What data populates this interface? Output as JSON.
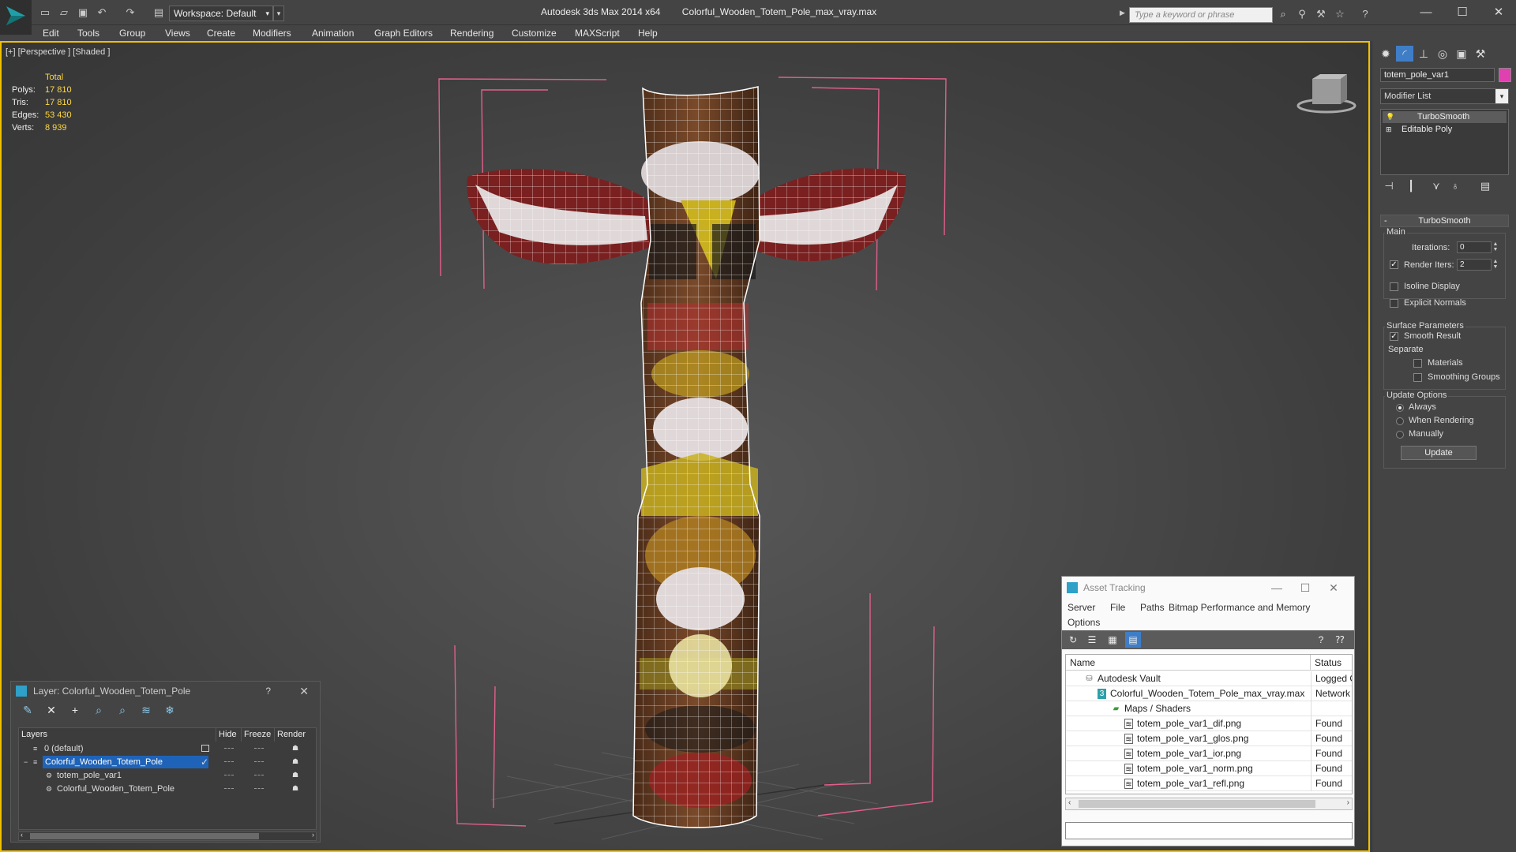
{
  "titlebar": {
    "workspace": "Workspace: Default",
    "app_name": "Autodesk 3ds Max  2014 x64",
    "file_name": "Colorful_Wooden_Totem_Pole_max_vray.max",
    "search_placeholder": "Type a keyword or phrase"
  },
  "menu": [
    "Edit",
    "Tools",
    "Group",
    "Views",
    "Create",
    "Modifiers",
    "Animation",
    "Graph Editors",
    "Rendering",
    "Customize",
    "MAXScript",
    "Help"
  ],
  "viewport": {
    "label": "[+] [Perspective ] [Shaded ]",
    "stats_header": "Total",
    "stats": [
      {
        "k": "Polys:",
        "v": "17 810"
      },
      {
        "k": "Tris:",
        "v": "17 810"
      },
      {
        "k": "Edges:",
        "v": "53 430"
      },
      {
        "k": "Verts:",
        "v": "8 939"
      }
    ]
  },
  "command_panel": {
    "object_name": "totem_pole_var1",
    "object_color": "#e040b0",
    "modifier_list": "Modifier List",
    "stack": [
      "TurboSmooth",
      "Editable Poly"
    ],
    "rollout_title": "TurboSmooth",
    "main_label": "Main",
    "iterations_label": "Iterations:",
    "iterations_value": "0",
    "render_iters_label": "Render Iters:",
    "render_iters_value": "2",
    "isoline_label": "Isoline Display",
    "explicit_normals_label": "Explicit Normals",
    "surface_params_label": "Surface Parameters",
    "smooth_result_label": "Smooth Result",
    "separate_label": "Separate",
    "materials_label": "Materials",
    "smoothing_groups_label": "Smoothing Groups",
    "update_options_label": "Update Options",
    "always_label": "Always",
    "when_rendering_label": "When Rendering",
    "manually_label": "Manually",
    "update_button": "Update"
  },
  "layer_panel": {
    "title": "Layer: Colorful_Wooden_Totem_Pole",
    "help": "?",
    "columns": [
      "Layers",
      "Hide",
      "Freeze",
      "Render"
    ],
    "rows": [
      {
        "name": "0 (default)"
      },
      {
        "name": "Colorful_Wooden_Totem_Pole"
      },
      {
        "name": "totem_pole_var1"
      },
      {
        "name": "Colorful_Wooden_Totem_Pole"
      }
    ]
  },
  "asset_tracking": {
    "title": "Asset Tracking",
    "menu": [
      "Server",
      "File",
      "Paths",
      "Bitmap Performance and Memory",
      "Options"
    ],
    "columns": [
      "Name",
      "Status"
    ],
    "rows": [
      {
        "name": "Autodesk Vault",
        "status": "Logged Out"
      },
      {
        "name": "Colorful_Wooden_Totem_Pole_max_vray.max",
        "status": "Network Path"
      },
      {
        "name": "Maps / Shaders",
        "status": ""
      },
      {
        "name": "totem_pole_var1_dif.png",
        "status": "Found"
      },
      {
        "name": "totem_pole_var1_glos.png",
        "status": "Found"
      },
      {
        "name": "totem_pole_var1_ior.png",
        "status": "Found"
      },
      {
        "name": "totem_pole_var1_norm.png",
        "status": "Found"
      },
      {
        "name": "totem_pole_var1_refl.png",
        "status": "Found"
      }
    ]
  }
}
